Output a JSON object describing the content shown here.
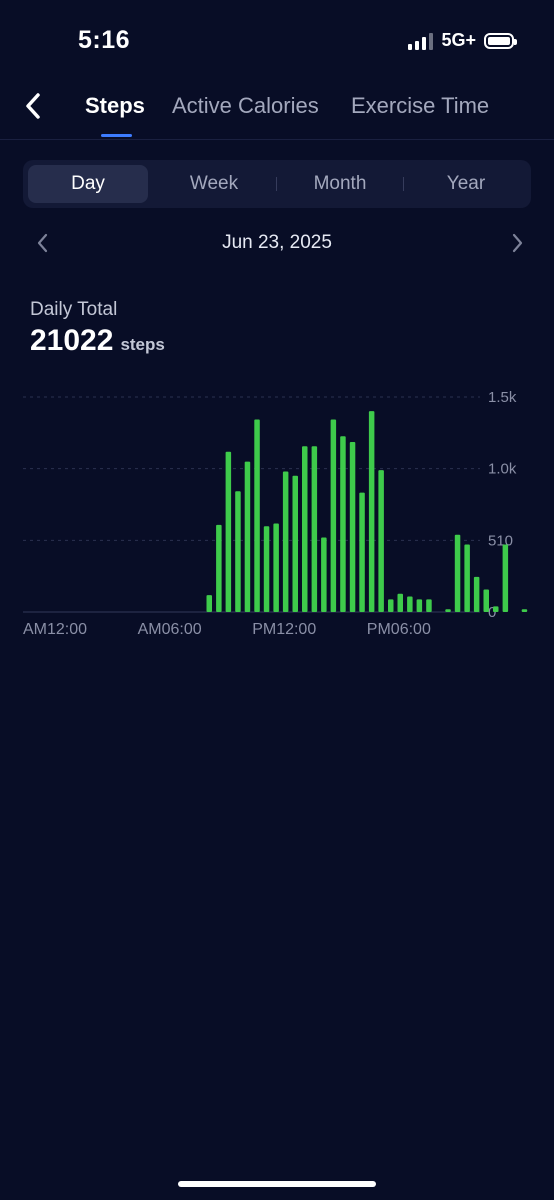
{
  "status_bar": {
    "time": "5:16",
    "network": "5G+"
  },
  "tabs": [
    {
      "label": "Steps",
      "active": true
    },
    {
      "label": "Active Calories",
      "active": false
    },
    {
      "label": "Exercise Time",
      "active": false
    }
  ],
  "periods": [
    {
      "label": "Day",
      "active": true
    },
    {
      "label": "Week",
      "active": false
    },
    {
      "label": "Month",
      "active": false
    },
    {
      "label": "Year",
      "active": false
    }
  ],
  "date_nav": {
    "date": "Jun 23, 2025"
  },
  "summary": {
    "label": "Daily Total",
    "value": "21022",
    "unit": "steps"
  },
  "colors": {
    "background": "#080d26",
    "bar": "#3ecb4b",
    "accent": "#3d7cff",
    "gridline": "#2a3150",
    "axis_text": "#8a8fa6"
  },
  "chart_data": {
    "type": "bar",
    "ylim": [
      0,
      1530
    ],
    "y_ticks": [
      {
        "value": 1530,
        "label": "1.5k"
      },
      {
        "value": 1020,
        "label": "1.0k"
      },
      {
        "value": 510,
        "label": "510"
      },
      {
        "value": 0,
        "label": "0"
      }
    ],
    "x_ticks": [
      {
        "slot": 0,
        "label": "AM12:00"
      },
      {
        "slot": 12,
        "label": "AM06:00"
      },
      {
        "slot": 24,
        "label": "PM12:00"
      },
      {
        "slot": 36,
        "label": "PM06:00"
      }
    ],
    "slots": 48,
    "slot_minutes": 30,
    "values": [
      0,
      0,
      0,
      0,
      0,
      0,
      0,
      0,
      0,
      0,
      120,
      620,
      1140,
      860,
      1070,
      1370,
      610,
      630,
      1000,
      970,
      1180,
      1180,
      530,
      1370,
      1250,
      1210,
      850,
      1430,
      1010,
      90,
      130,
      110,
      90,
      90,
      0,
      20,
      550,
      480,
      250,
      160,
      40,
      480,
      0,
      20,
      0,
      0,
      0,
      0
    ],
    "grid": true,
    "legend": "none"
  }
}
